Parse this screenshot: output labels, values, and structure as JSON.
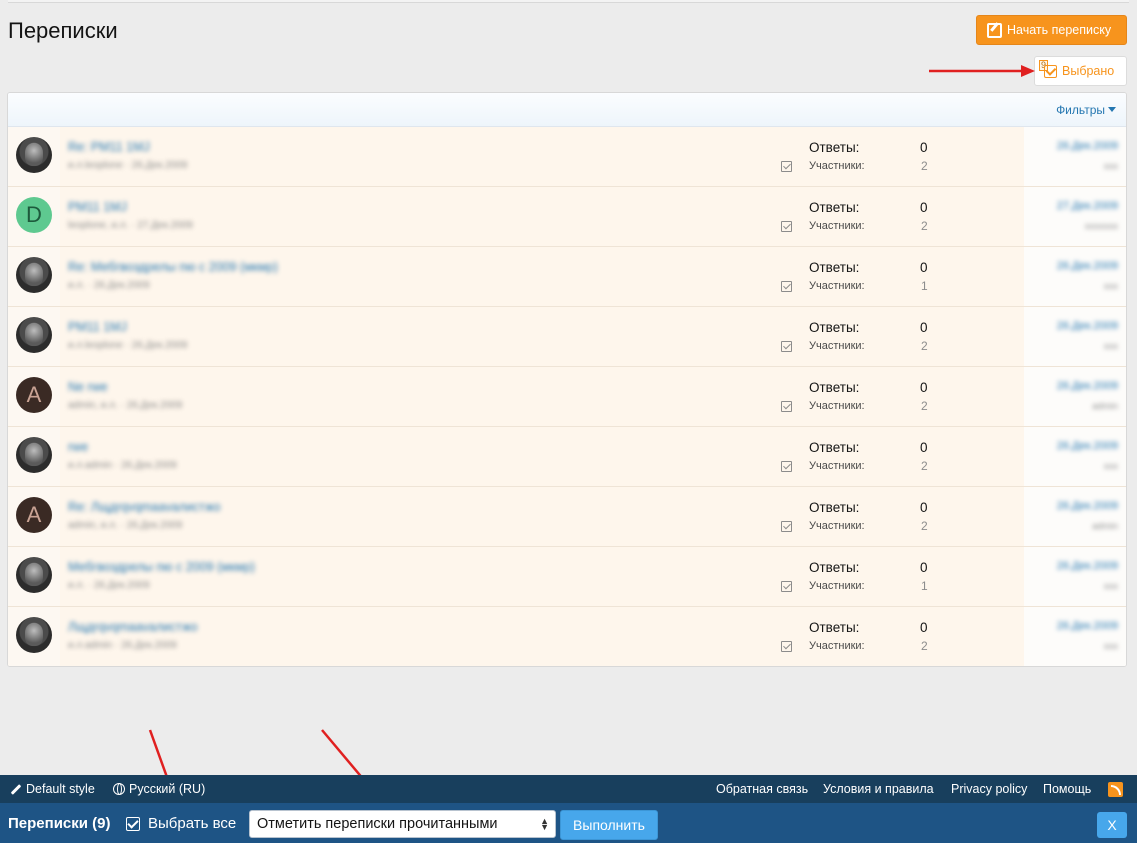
{
  "page": {
    "title": "Переписки",
    "start_button": "Начать переписку",
    "selected_button": "Выбрано",
    "selected_count": "9",
    "filters_label": "Фильтры"
  },
  "labels": {
    "replies": "Ответы:",
    "members": "Участники:"
  },
  "conversations": [
    {
      "title": "Re: PM11 1MJ",
      "meta": "и.л.leoplone · 26.Дек.2009",
      "replies": "0",
      "members": "2",
      "date": "26.Дек.2009",
      "user": "ххх",
      "avatar": "photo"
    },
    {
      "title": "PM11 1MJ",
      "meta": "leoplone, и.л. · 27.Дек.2009",
      "replies": "0",
      "members": "2",
      "date": "27.Дек.2009",
      "user": "ххххххх",
      "avatar": "D"
    },
    {
      "title": "Re: Мебгвоздрелы пю с 2009 (мкмр)",
      "meta": "и.л. · 26.Дек.2009",
      "replies": "0",
      "members": "1",
      "date": "26.Дек.2009",
      "user": "ххх",
      "avatar": "photo"
    },
    {
      "title": "PM11 1MJ",
      "meta": "и.л.leoplone · 26.Дек.2009",
      "replies": "0",
      "members": "2",
      "date": "26.Дек.2009",
      "user": "ххх",
      "avatar": "photo"
    },
    {
      "title": "Ne rwe",
      "meta": "admin, и.л. · 26.Дек.2009",
      "replies": "0",
      "members": "2",
      "date": "26.Дек.2009",
      "user": "admin",
      "avatar": "A"
    },
    {
      "title": "rwe",
      "meta": "и.л.admin · 26.Дек.2009",
      "replies": "0",
      "members": "2",
      "date": "26.Дек.2009",
      "user": "ххх",
      "avatar": "photo"
    },
    {
      "title": "Re: Лщдrqvqmaavaлистжо",
      "meta": "admin, и.л. · 26.Дек.2009",
      "replies": "0",
      "members": "2",
      "date": "26.Дек.2009",
      "user": "admin",
      "avatar": "A"
    },
    {
      "title": "Мебгвоздрелы пю с 2009 (мкмр)",
      "meta": "и.л. · 26.Дек.2009",
      "replies": "0",
      "members": "1",
      "date": "26.Дек.2009",
      "user": "ххх",
      "avatar": "photo"
    },
    {
      "title": "Лщдrqvqmaavaлистжо",
      "meta": "и.л.admin · 26.Дек.2009",
      "replies": "0",
      "members": "2",
      "date": "26.Дек.2009",
      "user": "ххх",
      "avatar": "photo"
    }
  ],
  "footer": {
    "style": "Default style",
    "language": "Русский (RU)",
    "links": [
      "Обратная связь",
      "Условия и правила",
      "Privacy policy",
      "Помощь"
    ]
  },
  "action_bar": {
    "title": "Переписки (9)",
    "select_all": "Выбрать все",
    "action_selected": "Отметить переписки прочитанными",
    "execute": "Выполнить",
    "close": "X"
  },
  "colors": {
    "accent": "#f7941d",
    "link": "#2577b1",
    "footer": "#183f5d",
    "action_bar": "#1e5485",
    "button_blue": "#47a7eb",
    "row_bg": "#fef6ec",
    "annotation_arrow": "#e02020"
  }
}
